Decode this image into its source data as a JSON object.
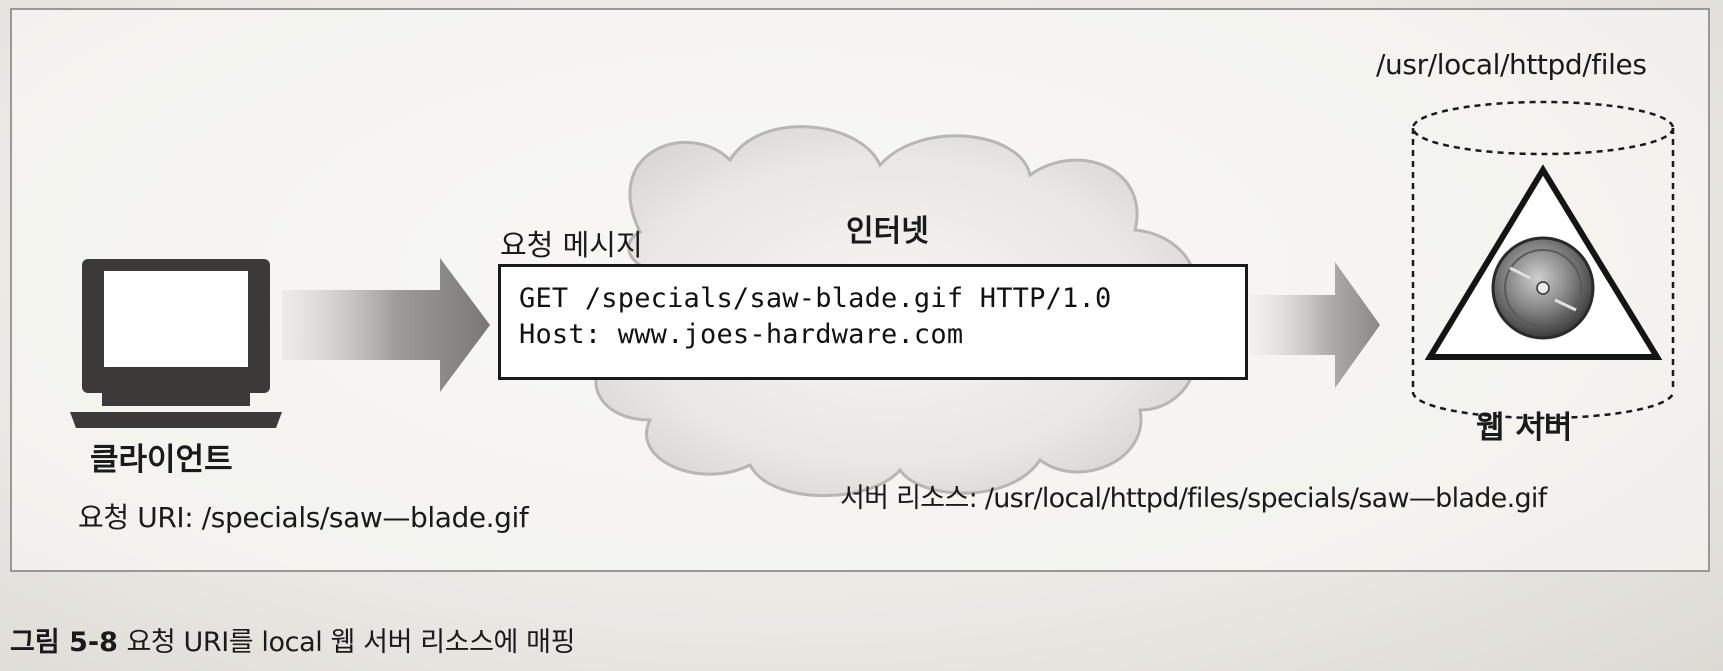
{
  "diagram": {
    "internet_label": "인터넷",
    "request_message_label": "요청 메시지",
    "request_lines": [
      "GET /specials/saw-blade.gif HTTP/1.0",
      "Host: www.joes-hardware.com"
    ],
    "client_label": "클라이언트",
    "client_uri_label": "요청 URI: /specials/saw—blade.gif",
    "server_path_label": "/usr/local/httpd/files",
    "server_label": "웹 서버",
    "server_resource_label": "서버 리소스: /usr/local/httpd/files/specials/saw—blade.gif",
    "icons": [
      "computer-icon",
      "arrow-right-icon",
      "cloud-icon",
      "cylinder-icon",
      "saw-blade-icon"
    ]
  },
  "caption": {
    "figure_number": "그림 5-8",
    "text": "요청 URI를 local 웹 서버 리소스에 매핑"
  }
}
